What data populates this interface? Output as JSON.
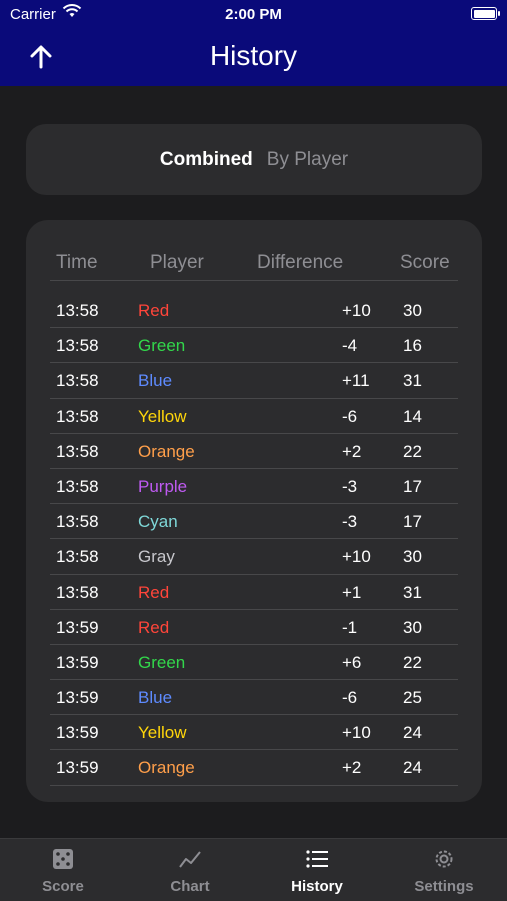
{
  "status_bar": {
    "carrier": "Carrier",
    "time": "2:00 PM"
  },
  "nav": {
    "title": "History",
    "back_icon": "arrow-up-icon"
  },
  "segment": {
    "options": [
      "Combined",
      "By Player"
    ],
    "selected": "Combined"
  },
  "table": {
    "headers": {
      "time": "Time",
      "player": "Player",
      "difference": "Difference",
      "score": "Score"
    },
    "rows": [
      {
        "time": "13:58",
        "player": "Red",
        "difference": "+10",
        "score": "30",
        "color": "#ff453a"
      },
      {
        "time": "13:58",
        "player": "Green",
        "difference": "-4",
        "score": "16",
        "color": "#32d74b"
      },
      {
        "time": "13:58",
        "player": "Blue",
        "difference": "+11",
        "score": "31",
        "color": "#5e8bff"
      },
      {
        "time": "13:58",
        "player": "Yellow",
        "difference": "-6",
        "score": "14",
        "color": "#ffd60a"
      },
      {
        "time": "13:58",
        "player": "Orange",
        "difference": "+2",
        "score": "22",
        "color": "#ff9f4a"
      },
      {
        "time": "13:58",
        "player": "Purple",
        "difference": "-3",
        "score": "17",
        "color": "#bf5af2"
      },
      {
        "time": "13:58",
        "player": "Cyan",
        "difference": "-3",
        "score": "17",
        "color": "#7fd8d8"
      },
      {
        "time": "13:58",
        "player": "Gray",
        "difference": "+10",
        "score": "30",
        "color": "#c7c7cc"
      },
      {
        "time": "13:58",
        "player": "Red",
        "difference": "+1",
        "score": "31",
        "color": "#ff453a"
      },
      {
        "time": "13:59",
        "player": "Red",
        "difference": "-1",
        "score": "30",
        "color": "#ff453a"
      },
      {
        "time": "13:59",
        "player": "Green",
        "difference": "+6",
        "score": "22",
        "color": "#32d74b"
      },
      {
        "time": "13:59",
        "player": "Blue",
        "difference": "-6",
        "score": "25",
        "color": "#5e8bff"
      },
      {
        "time": "13:59",
        "player": "Yellow",
        "difference": "+10",
        "score": "24",
        "color": "#ffd60a"
      },
      {
        "time": "13:59",
        "player": "Orange",
        "difference": "+2",
        "score": "24",
        "color": "#ff9f4a"
      }
    ]
  },
  "tabs": [
    {
      "label": "Score",
      "icon": "dice-icon",
      "active": false
    },
    {
      "label": "Chart",
      "icon": "line-chart-icon",
      "active": false
    },
    {
      "label": "History",
      "icon": "list-icon",
      "active": true
    },
    {
      "label": "Settings",
      "icon": "gear-icon",
      "active": false
    }
  ],
  "colors": {
    "nav_bg": "#0a0a7a",
    "background": "#1c1c1e",
    "card": "#2c2c2e"
  }
}
